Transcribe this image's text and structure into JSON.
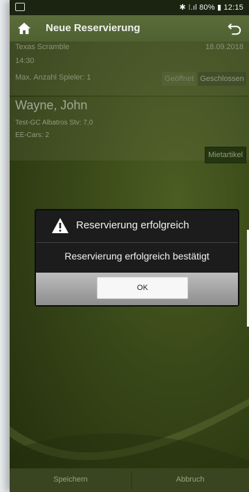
{
  "status_bar": {
    "right": "✱ ⁝.ıl 80% ▮ 12:15"
  },
  "header": {
    "title": "Neue Reservierung"
  },
  "reservation": {
    "event": "Texas Scramble",
    "date": "18.09.2018",
    "time": "14:30",
    "max_players": "Max. Anzahl Spieler: 1",
    "status_open": "Geöffnet",
    "status_closed": "Geschlossen"
  },
  "player": {
    "name": "Wayne, John",
    "club": "Test-GC Albatros Stv: 7,0",
    "cars": "EE-Cars: 2",
    "rental_button": "Mietartikel"
  },
  "dialog": {
    "title": "Reservierung erfolgreich",
    "message": "Reservierung erfolgreich bestätigt",
    "ok_label": "OK"
  },
  "footer": {
    "save_label": "Speichern",
    "cancel_label": "Abbruch"
  }
}
